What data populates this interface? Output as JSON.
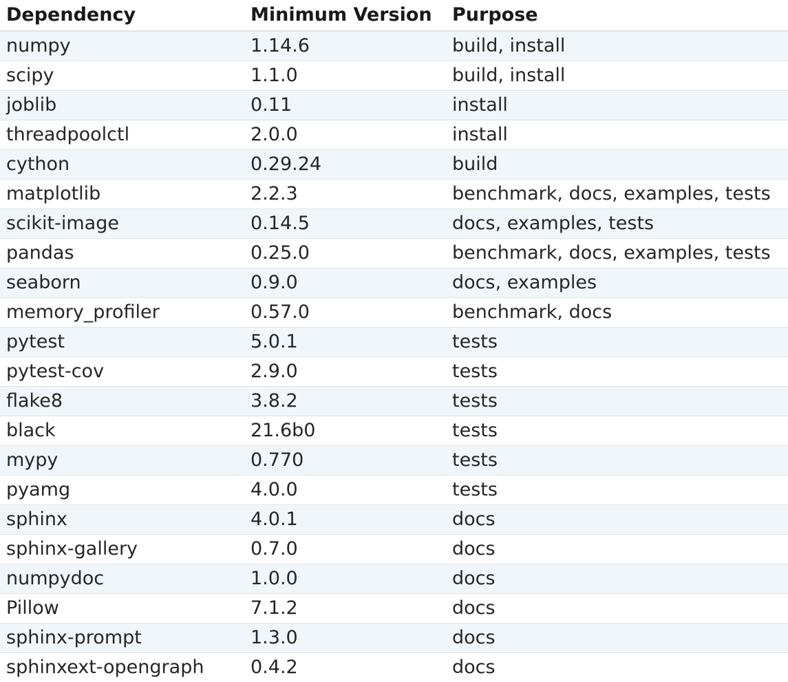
{
  "table": {
    "headers": {
      "dependency": "Dependency",
      "minimum_version": "Minimum Version",
      "purpose": "Purpose"
    },
    "rows": [
      {
        "dependency": "numpy",
        "version": "1.14.6",
        "purpose": "build, install"
      },
      {
        "dependency": "scipy",
        "version": "1.1.0",
        "purpose": "build, install"
      },
      {
        "dependency": "joblib",
        "version": "0.11",
        "purpose": "install"
      },
      {
        "dependency": "threadpoolctl",
        "version": "2.0.0",
        "purpose": "install"
      },
      {
        "dependency": "cython",
        "version": "0.29.24",
        "purpose": "build"
      },
      {
        "dependency": "matplotlib",
        "version": "2.2.3",
        "purpose": "benchmark, docs, examples, tests"
      },
      {
        "dependency": "scikit-image",
        "version": "0.14.5",
        "purpose": "docs, examples, tests"
      },
      {
        "dependency": "pandas",
        "version": "0.25.0",
        "purpose": "benchmark, docs, examples, tests"
      },
      {
        "dependency": "seaborn",
        "version": "0.9.0",
        "purpose": "docs, examples"
      },
      {
        "dependency": "memory_profiler",
        "version": "0.57.0",
        "purpose": "benchmark, docs"
      },
      {
        "dependency": "pytest",
        "version": "5.0.1",
        "purpose": "tests"
      },
      {
        "dependency": "pytest-cov",
        "version": "2.9.0",
        "purpose": "tests"
      },
      {
        "dependency": "flake8",
        "version": "3.8.2",
        "purpose": "tests"
      },
      {
        "dependency": "black",
        "version": "21.6b0",
        "purpose": "tests"
      },
      {
        "dependency": "mypy",
        "version": "0.770",
        "purpose": "tests"
      },
      {
        "dependency": "pyamg",
        "version": "4.0.0",
        "purpose": "tests"
      },
      {
        "dependency": "sphinx",
        "version": "4.0.1",
        "purpose": "docs"
      },
      {
        "dependency": "sphinx-gallery",
        "version": "0.7.0",
        "purpose": "docs"
      },
      {
        "dependency": "numpydoc",
        "version": "1.0.0",
        "purpose": "docs"
      },
      {
        "dependency": "Pillow",
        "version": "7.1.2",
        "purpose": "docs"
      },
      {
        "dependency": "sphinx-prompt",
        "version": "1.3.0",
        "purpose": "docs"
      },
      {
        "dependency": "sphinxext-opengraph",
        "version": "0.4.2",
        "purpose": "docs"
      }
    ]
  }
}
